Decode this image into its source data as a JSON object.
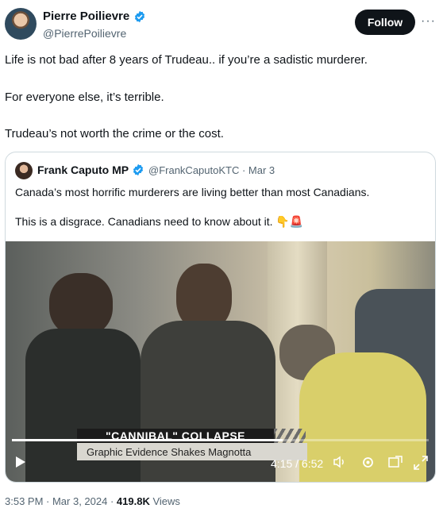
{
  "author": {
    "name": "Pierre Poilievre",
    "handle": "@PierrePoilievre"
  },
  "follow_label": "Follow",
  "more_label": "···",
  "tweet": {
    "line1": "Life is not bad after 8 years of Trudeau.. if you’re a sadistic murderer.",
    "line2": "For everyone else, it’s terrible.",
    "line3": "Trudeau’s not worth the crime or the cost."
  },
  "quote": {
    "name": "Frank Caputo MP",
    "handle_date": "@FrankCaputoKTC · Mar 3",
    "line1": "Canada’s most horrific murderers are living better than most Canadians.",
    "line2": "This is a disgrace. Canadians need to know about it. 👇🚨"
  },
  "video": {
    "chyron_title": "\"CANNIBAL\" COLLAPSE",
    "chyron_subtitle": "Graphic Evidence Shakes Magnotta",
    "time": "4:15 / 6:52",
    "progress": 0.65
  },
  "footer": {
    "time_date": "3:53 PM · Mar 3, 2024 · ",
    "views_count": "419.8K",
    "views_label": " Views"
  },
  "colors": {
    "verified": "#1d9bf0",
    "text": "#0f1419",
    "muted": "#536471"
  }
}
